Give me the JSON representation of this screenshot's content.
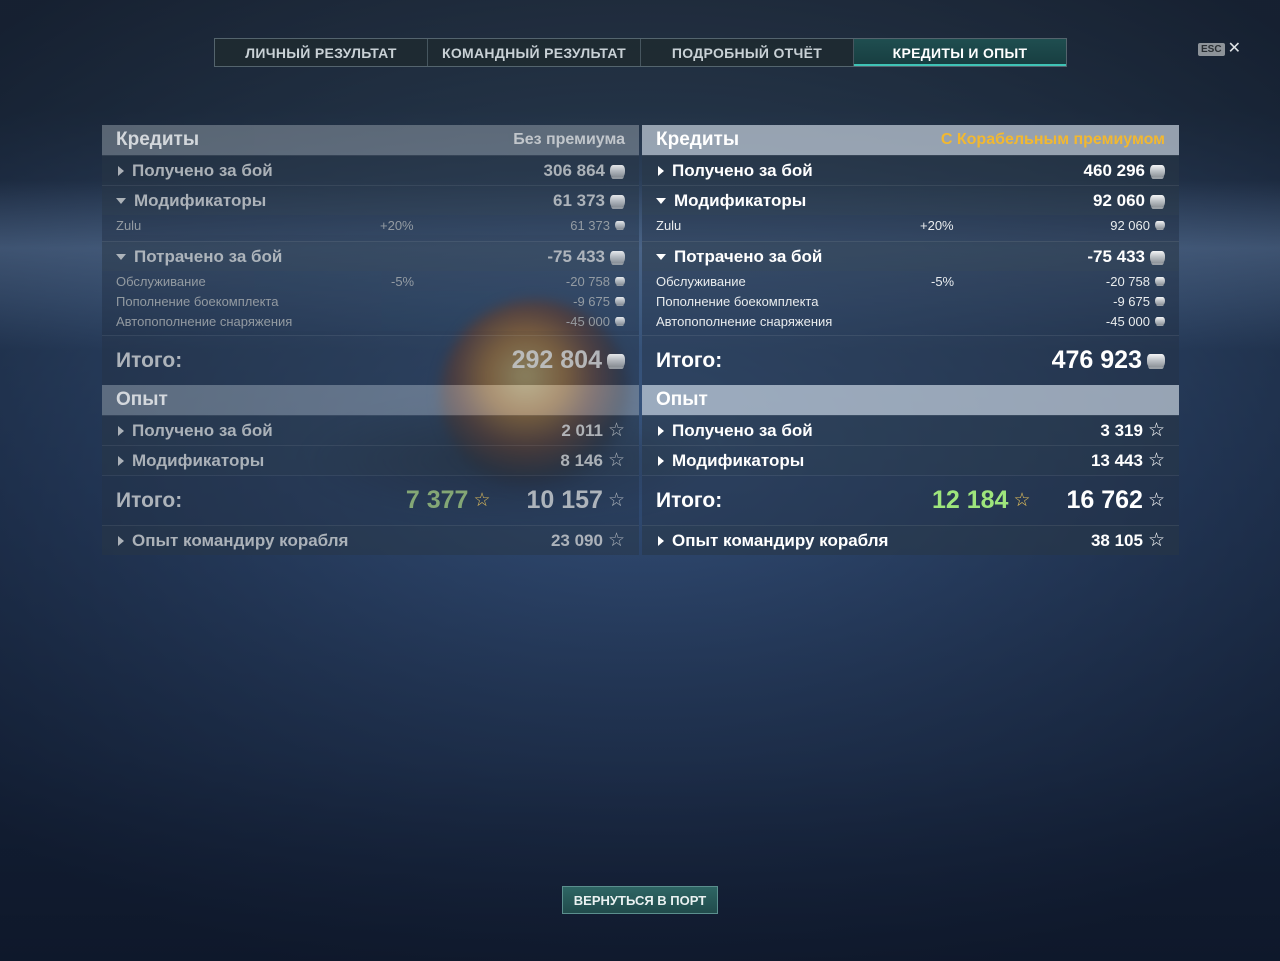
{
  "tabs": [
    {
      "label": "ЛИЧНЫЙ РЕЗУЛЬТАТ",
      "active": false
    },
    {
      "label": "КОМАНДНЫЙ РЕЗУЛЬТАТ",
      "active": false
    },
    {
      "label": "ПОДРОБНЫЙ ОТЧЁТ",
      "active": false
    },
    {
      "label": "КРЕДИТЫ И ОПЫТ",
      "active": true
    }
  ],
  "esc": {
    "key": "ESC",
    "close": "✕"
  },
  "left": {
    "credits_title": "Кредиты",
    "credits_mode": "Без премиума",
    "received_label": "Получено за бой",
    "received_value": "306 864",
    "modifiers_label": "Модификаторы",
    "modifiers_value": "61 373",
    "mod_items": [
      {
        "name": "Zulu",
        "pct": "+20%",
        "value": "61 373"
      }
    ],
    "spent_label": "Потрачено за бой",
    "spent_value": "-75 433",
    "spent_items": [
      {
        "name": "Обслуживание",
        "pct": "-5%",
        "value": "-20 758"
      },
      {
        "name": "Пополнение боекомплекта",
        "pct": "",
        "value": "-9 675"
      },
      {
        "name": "Автопополнение снаряжения",
        "pct": "",
        "value": "-45 000"
      }
    ],
    "total_label": "Итого:",
    "total_credits": "292 804",
    "xp_title": "Опыт",
    "xp_received_label": "Получено за бой",
    "xp_received_value": "2 011",
    "xp_mod_label": "Модификаторы",
    "xp_mod_value": "8 146",
    "xp_total_label": "Итого:",
    "xp_total_free": "7 377",
    "xp_total": "10 157",
    "commander_label": "Опыт командиру корабля",
    "commander_value": "23 090"
  },
  "right": {
    "credits_title": "Кредиты",
    "credits_mode": "С Корабельным премиумом",
    "received_label": "Получено за бой",
    "received_value": "460 296",
    "modifiers_label": "Модификаторы",
    "modifiers_value": "92 060",
    "mod_items": [
      {
        "name": "Zulu",
        "pct": "+20%",
        "value": "92 060"
      }
    ],
    "spent_label": "Потрачено за бой",
    "spent_value": "-75 433",
    "spent_items": [
      {
        "name": "Обслуживание",
        "pct": "-5%",
        "value": "-20 758"
      },
      {
        "name": "Пополнение боекомплекта",
        "pct": "",
        "value": "-9 675"
      },
      {
        "name": "Автопополнение снаряжения",
        "pct": "",
        "value": "-45 000"
      }
    ],
    "total_label": "Итого:",
    "total_credits": "476 923",
    "xp_title": "Опыт",
    "xp_received_label": "Получено за бой",
    "xp_received_value": "3 319",
    "xp_mod_label": "Модификаторы",
    "xp_mod_value": "13 443",
    "xp_total_label": "Итого:",
    "xp_total_free": "12 184",
    "xp_total": "16 762",
    "commander_label": "Опыт командиру корабля",
    "commander_value": "38 105"
  },
  "footer": {
    "return_label": "ВЕРНУТЬСЯ В ПОРТ"
  },
  "colors": {
    "accent": "#3fc3b6",
    "premium": "#f2b830",
    "free_xp": "#9ee57c"
  }
}
